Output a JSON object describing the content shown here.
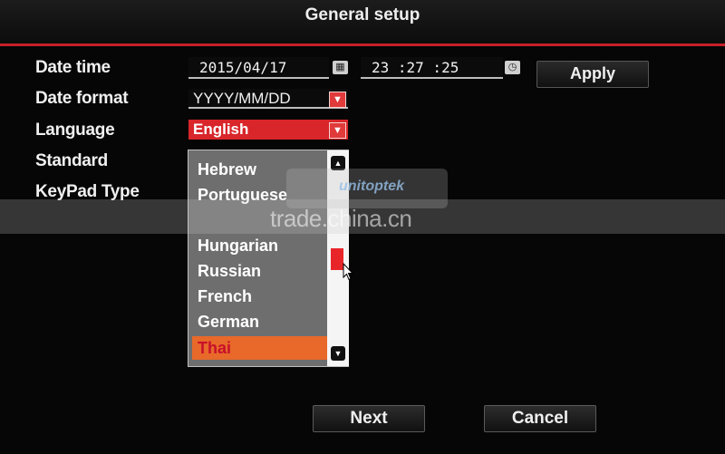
{
  "header": {
    "title": "General setup"
  },
  "labels": {
    "date_time": "Date time",
    "date_format": "Date format",
    "language": "Language",
    "standard": "Standard",
    "keypad_type": "KeyPad Type"
  },
  "date_time": {
    "date": "2015/04/17",
    "time": "23 :27 :25"
  },
  "date_format": {
    "value": "YYYY/MM/DD"
  },
  "language": {
    "value": "English",
    "options": [
      "Hebrew",
      "Portuguese",
      "Hungarian",
      "Russian",
      "French",
      "German",
      "Thai"
    ],
    "highlighted": "Thai"
  },
  "buttons": {
    "apply": "Apply",
    "next": "Next",
    "cancel": "Cancel"
  },
  "watermark": {
    "logo": "unitoptek",
    "site": "trade.china.cn"
  },
  "colors": {
    "accent_red": "#d8262a",
    "highlight_orange": "#e8692a",
    "dropdown_gray": "#6e6e6e"
  }
}
